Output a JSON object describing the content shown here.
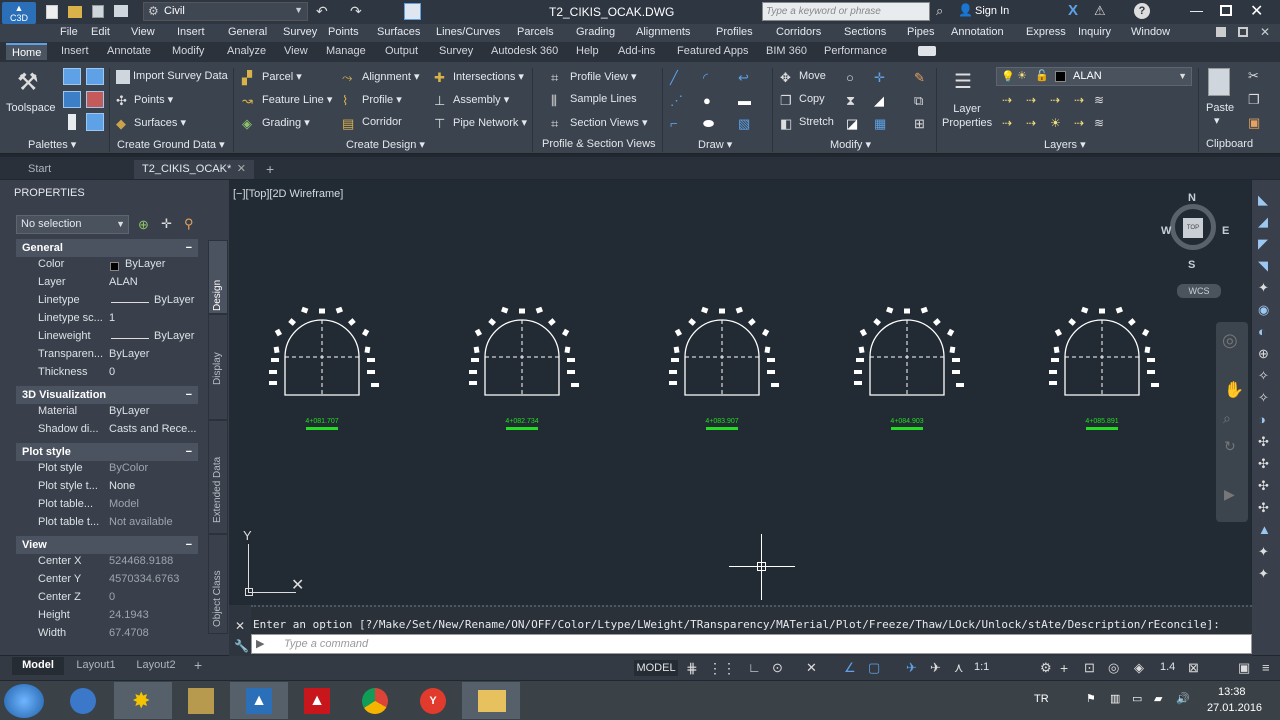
{
  "title": {
    "workspace": "Civil",
    "filename": "T2_CIKIS_OCAK.DWG",
    "search_placeholder": "Type a keyword or phrase",
    "signin": "Sign In"
  },
  "menu": [
    "File",
    "Edit",
    "View",
    "Insert",
    "General",
    "Survey",
    "Points",
    "Surfaces",
    "Lines/Curves",
    "Parcels",
    "Grading",
    "Alignments",
    "Profiles",
    "Corridors",
    "Sections",
    "Pipes",
    "Annotation",
    "Express",
    "Inquiry",
    "Window"
  ],
  "ribbon_tabs": [
    "Home",
    "Insert",
    "Annotate",
    "Modify",
    "Analyze",
    "View",
    "Manage",
    "Output",
    "Survey",
    "Autodesk 360",
    "Help",
    "Add-ins",
    "Featured Apps",
    "BIM 360",
    "Performance"
  ],
  "ribbon": {
    "toolspace": "Toolspace",
    "import_survey": "Import Survey Data",
    "points": "Points",
    "surfaces": "Surfaces",
    "parcel": "Parcel",
    "feature_line": "Feature Line",
    "grading": "Grading",
    "alignment": "Alignment",
    "profile": "Profile",
    "corridor": "Corridor",
    "intersections": "Intersections",
    "assembly": "Assembly",
    "pipe_network": "Pipe Network",
    "profile_view": "Profile View",
    "sample_lines": "Sample Lines",
    "section_views": "Section Views",
    "move": "Move",
    "copy": "Copy",
    "stretch": "Stretch",
    "layer_properties_1": "Layer",
    "layer_properties_2": "Properties",
    "layer_name": "ALAN",
    "paste": "Paste",
    "panels": {
      "palettes": "Palettes",
      "create_ground": "Create Ground Data",
      "create_design": "Create Design",
      "profile_section": "Profile & Section Views",
      "draw": "Draw",
      "modify": "Modify",
      "layers": "Layers",
      "clipboard": "Clipboard"
    }
  },
  "doc_tabs": {
    "start": "Start",
    "active": "T2_CIKIS_OCAK*"
  },
  "properties": {
    "title": "PROPERTIES",
    "selection": "No selection",
    "general": {
      "header": "General",
      "rows": [
        {
          "label": "Color",
          "value": "ByLayer"
        },
        {
          "label": "Layer",
          "value": "ALAN"
        },
        {
          "label": "Linetype",
          "value": "ByLayer"
        },
        {
          "label": "Linetype sc...",
          "value": "1"
        },
        {
          "label": "Lineweight",
          "value": "ByLayer"
        },
        {
          "label": "Transparen...",
          "value": "ByLayer"
        },
        {
          "label": "Thickness",
          "value": "0"
        }
      ]
    },
    "viz": {
      "header": "3D Visualization",
      "rows": [
        {
          "label": "Material",
          "value": "ByLayer"
        },
        {
          "label": "Shadow di...",
          "value": "Casts and Rece..."
        }
      ]
    },
    "plot": {
      "header": "Plot style",
      "rows": [
        {
          "label": "Plot style",
          "value": "ByColor"
        },
        {
          "label": "Plot style t...",
          "value": "None"
        },
        {
          "label": "Plot table...",
          "value": "Model"
        },
        {
          "label": "Plot table t...",
          "value": "Not available"
        }
      ]
    },
    "view": {
      "header": "View",
      "rows": [
        {
          "label": "Center X",
          "value": "524468.9188"
        },
        {
          "label": "Center Y",
          "value": "4570334.6763"
        },
        {
          "label": "Center Z",
          "value": "0"
        },
        {
          "label": "Height",
          "value": "24.1943"
        },
        {
          "label": "Width",
          "value": "67.4708"
        }
      ]
    },
    "side_tabs": [
      "Design",
      "Display",
      "Extended Data",
      "Object Class"
    ]
  },
  "viewport": {
    "label": "[−][Top][2D Wireframe]",
    "compass": {
      "n": "N",
      "s": "S",
      "e": "E",
      "w": "W",
      "top": "TOP",
      "wcs": "WCS"
    },
    "stations": [
      "4+081.707",
      "4+082.734",
      "4+083.907",
      "4+084.903",
      "4+085.891"
    ],
    "ucs_y": "Y"
  },
  "command": {
    "history": "Enter an option [?/Make/Set/New/Rename/ON/OFF/Color/Ltype/LWeight/TRansparency/MATerial/Plot/Freeze/Thaw/LOck/Unlock/stAte/Description/rEconcile]:",
    "placeholder": "Type a command"
  },
  "layout_tabs": [
    "Model",
    "Layout1",
    "Layout2"
  ],
  "status": {
    "model": "MODEL",
    "scale": "1:1",
    "zoom": "1.4"
  },
  "taskbar": {
    "lang": "TR",
    "time": "13:38",
    "date": "27.01.2016"
  },
  "colors": {
    "accent": "#5ea1e6",
    "station": "#22dd22",
    "draft": "#ffffff"
  }
}
